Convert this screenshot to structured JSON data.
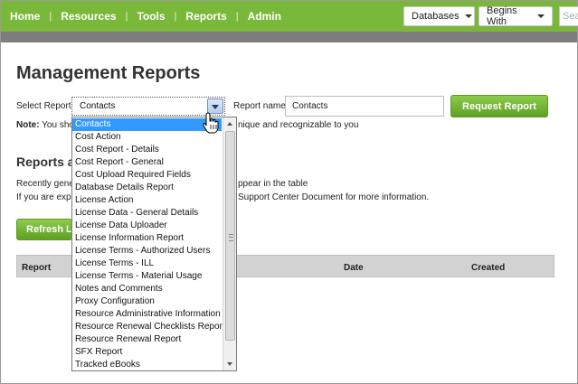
{
  "nav": {
    "items": [
      "Home",
      "Resources",
      "Tools",
      "Reports",
      "Admin"
    ],
    "separator": "|"
  },
  "toolbar": {
    "databases_label": "Databases",
    "begins_with_label": "Begins With",
    "search_placeholder": "Search"
  },
  "page": {
    "title": "Management Reports",
    "select_report_label": "Select Report",
    "selected_report": "Contacts",
    "report_name_label": "Report name",
    "report_name_value": "Contacts",
    "request_button": "Request Report",
    "note_label": "Note:",
    "note_text_visible_start": "You sho",
    "note_text_visible_end": "nique and recognizable to you",
    "reports_heading": "Reports a",
    "recent_text_start": "Recently gene",
    "recent_text_end": "ppear in the table",
    "expect_text_start": "If you are expe",
    "expect_text_end": " Support Center Document for more information.",
    "refresh_button": "Refresh L"
  },
  "table": {
    "columns": [
      "Report",
      "Date",
      "Created"
    ]
  },
  "dropdown": {
    "selected_index": 0,
    "options": [
      "Contacts",
      "Cost Action",
      "Cost Report - Details",
      "Cost Report - General",
      "Cost Upload Required Fields",
      "Database Details Report",
      "License Action",
      "License Data - General Details",
      "License Data Uploader",
      "License Information Report",
      "License Terms - Authorized Users",
      "License Terms - ILL",
      "License Terms - Material Usage",
      "Notes and Comments",
      "Proxy Configuration",
      "Resource Administrative Information",
      "Resource Renewal Checklists Report",
      "Resource Renewal Report",
      "SFX Report",
      "Tracked eBooks"
    ]
  },
  "colors": {
    "brand_green": "#7ab83a",
    "selection_blue": "#3399ff"
  }
}
